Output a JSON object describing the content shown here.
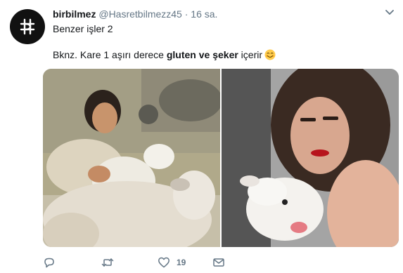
{
  "tweet": {
    "display_name": "birbilmez",
    "handle": "@Hasretbilmezz45",
    "separator": "·",
    "timestamp": "16 sa.",
    "text_line1": "Benzer işler 2",
    "text_line2_prefix": "Bknz. Kare 1 aşırı derece ",
    "text_line2_bold": "gluten ve şeker",
    "text_line2_suffix": " içerir"
  },
  "actions": {
    "reply_count": "",
    "retweet_count": "",
    "like_count": "19"
  },
  "icons": {
    "avatar": "hashtag-logo-icon",
    "caret": "chevron-down-icon",
    "emoji": "smiling-face-emoji",
    "reply": "reply-icon",
    "retweet": "retweet-icon",
    "like": "heart-icon",
    "message": "envelope-icon"
  },
  "colors": {
    "text": "#14171a",
    "secondary": "#657786",
    "avatar_bg": "#111111"
  }
}
